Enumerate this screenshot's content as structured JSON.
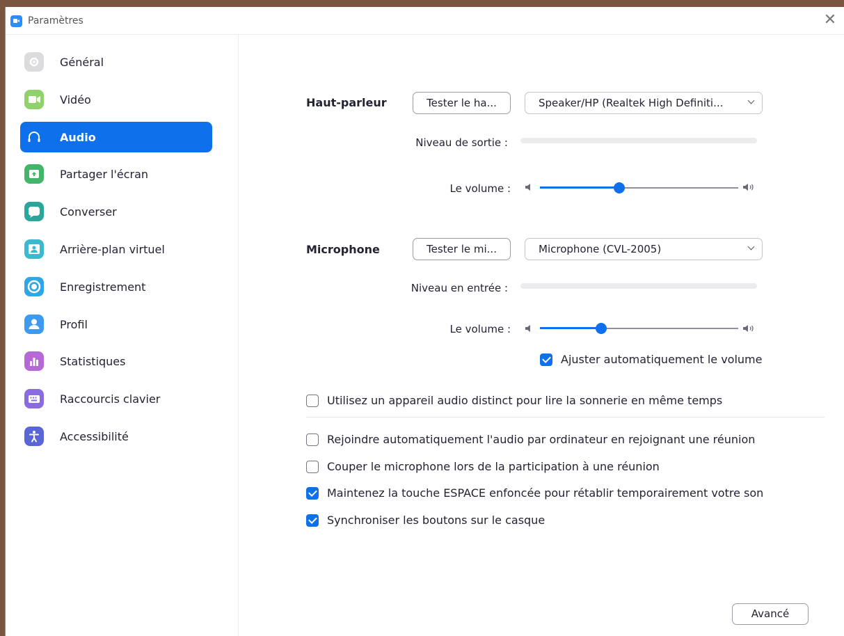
{
  "window": {
    "title": "Paramètres",
    "close_glyph": "✕"
  },
  "sidebar": {
    "items": [
      {
        "label": "Général",
        "icon": "gear-icon",
        "color": "#dcdcde",
        "active": false
      },
      {
        "label": "Vidéo",
        "icon": "video-icon",
        "color": "#8fd16b",
        "active": false
      },
      {
        "label": "Audio",
        "icon": "headphones-icon",
        "color": "#0e71eb",
        "active": true
      },
      {
        "label": "Partager l'écran",
        "icon": "share-screen-icon",
        "color": "#43b56b",
        "active": false
      },
      {
        "label": "Converser",
        "icon": "chat-icon",
        "color": "#2ba69b",
        "active": false
      },
      {
        "label": "Arrière-plan virtuel",
        "icon": "virtual-background-icon",
        "color": "#3db9cf",
        "active": false
      },
      {
        "label": "Enregistrement",
        "icon": "recording-icon",
        "color": "#2fa6e6",
        "active": false
      },
      {
        "label": "Profil",
        "icon": "profile-icon",
        "color": "#3d9aef",
        "active": false
      },
      {
        "label": "Statistiques",
        "icon": "statistics-icon",
        "color": "#b568d6",
        "active": false
      },
      {
        "label": "Raccourcis clavier",
        "icon": "keyboard-icon",
        "color": "#8a6be0",
        "active": false
      },
      {
        "label": "Accessibilité",
        "icon": "accessibility-icon",
        "color": "#5b66d6",
        "active": false
      }
    ]
  },
  "speaker": {
    "label": "Haut-parleur",
    "test_button": "Tester le ha...",
    "device": "Speaker/HP (Realtek High Definiti...",
    "output_level_label": "Niveau de sortie :",
    "volume_label": "Le volume :",
    "volume": 0.4
  },
  "microphone": {
    "label": "Microphone",
    "test_button": "Tester le mi...",
    "device": "Microphone (CVL-2005)",
    "input_level_label": "Niveau en entrée :",
    "volume_label": "Le volume :",
    "volume": 0.31,
    "auto_adjust": {
      "label": "Ajuster automatiquement le volume",
      "checked": true
    }
  },
  "options": {
    "separate_ringer": {
      "label": "Utilisez un appareil audio distinct pour lire la sonnerie en même temps",
      "checked": false
    },
    "auto_join": {
      "label": "Rejoindre automatiquement l'audio par ordinateur en rejoignant une réunion",
      "checked": false
    },
    "mute_on_join": {
      "label": "Couper le microphone lors de la participation à une réunion",
      "checked": false
    },
    "space_unmute": {
      "label": "Maintenez la touche ESPACE enfoncée pour rétablir temporairement votre son",
      "checked": true
    },
    "sync_headset": {
      "label": "Synchroniser les boutons sur le casque",
      "checked": true
    }
  },
  "advanced_button": "Avancé",
  "colors": {
    "accent": "#0e71eb"
  }
}
